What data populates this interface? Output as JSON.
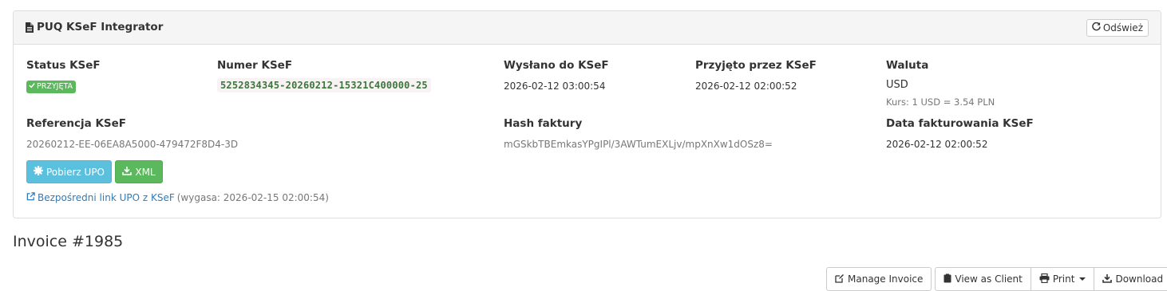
{
  "panel": {
    "title": "PUQ KSeF Integrator",
    "refresh_label": "Odśwież"
  },
  "fields": {
    "status_label": "Status KSeF",
    "status_value": "PRZYJĘTA",
    "numer_label": "Numer KSeF",
    "numer_value": "5252834345-20260212-15321C400000-25",
    "wyslano_label": "Wysłano do KSeF",
    "wyslano_value": "2026-02-12 03:00:54",
    "przyjeto_label": "Przyjęto przez KSeF",
    "przyjeto_value": "2026-02-12 02:00:52",
    "waluta_label": "Waluta",
    "waluta_value": "USD",
    "kurs_value": "Kurs: 1 USD = 3.54 PLN",
    "referencja_label": "Referencja KSeF",
    "referencja_value": "20260212-EE-06EA8A5000-479472F8D4-3D",
    "hash_label": "Hash faktury",
    "hash_value": "mGSkbTBEmkasYPgIPl/3AWTumEXLjv/mpXnXw1dOSz8=",
    "data_label": "Data fakturowania KSeF",
    "data_value": "2026-02-12 02:00:52"
  },
  "buttons": {
    "pobierz_upo": "Pobierz UPO",
    "xml": "XML"
  },
  "upo_link": {
    "text": "Bezpośredni link UPO z KSeF",
    "expiry": "(wygasa: 2026-02-15 02:00:54)"
  },
  "invoice": {
    "title": "Invoice #1985"
  },
  "toolbar": {
    "manage": "Manage Invoice",
    "view_client": "View as Client",
    "print": "Print",
    "download": "Download"
  },
  "colors": {
    "success": "#5cb85c",
    "info": "#5bc0de",
    "link": "#337ab7"
  }
}
